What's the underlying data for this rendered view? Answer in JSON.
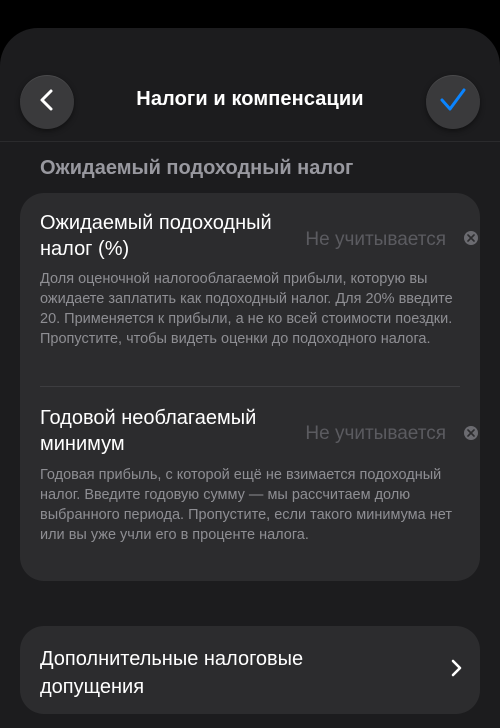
{
  "header": {
    "title": "Налоги и компенсации"
  },
  "section": {
    "title": "Ожидаемый подоходный налог"
  },
  "rows": [
    {
      "title": "Ожидаемый подоходный налог (%)",
      "value": "Не учитывается",
      "description": "Доля оценочной налогооблагаемой прибыли, которую вы ожидаете заплатить как подоходный налог. Для 20% введите 20. Применяется к прибыли, а не ко всей стоимости поездки. Пропустите, чтобы видеть оценки до подоходного налога."
    },
    {
      "title": "Годовой необлагаемый минимум",
      "value": "Не учитывается",
      "description": "Годовая прибыль, с которой ещё не взимается подоходный налог. Введите годовую сумму — мы рассчитаем долю выбранного периода. Пропустите, если такого минимума нет или вы уже учли его в проценте налога."
    }
  ],
  "extra": {
    "label": "Дополнительные налоговые допущения"
  },
  "colors": {
    "accent": "#0a84ff",
    "background": "#1c1c1e",
    "card": "#2c2c2e"
  }
}
